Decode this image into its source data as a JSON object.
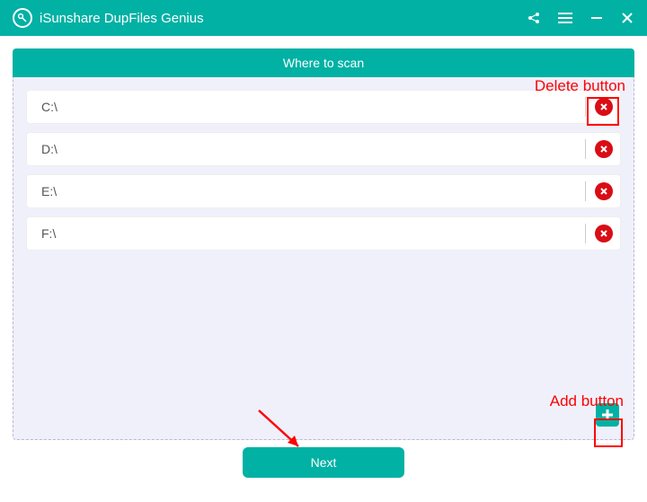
{
  "app": {
    "title": "iSunshare DupFiles Genius"
  },
  "panel": {
    "header": "Where to scan"
  },
  "paths": [
    {
      "value": "C:\\"
    },
    {
      "value": "D:\\"
    },
    {
      "value": "E:\\"
    },
    {
      "value": "F:\\"
    }
  ],
  "buttons": {
    "next": "Next"
  },
  "annotations": {
    "delete": "Delete button",
    "add": "Add button"
  }
}
